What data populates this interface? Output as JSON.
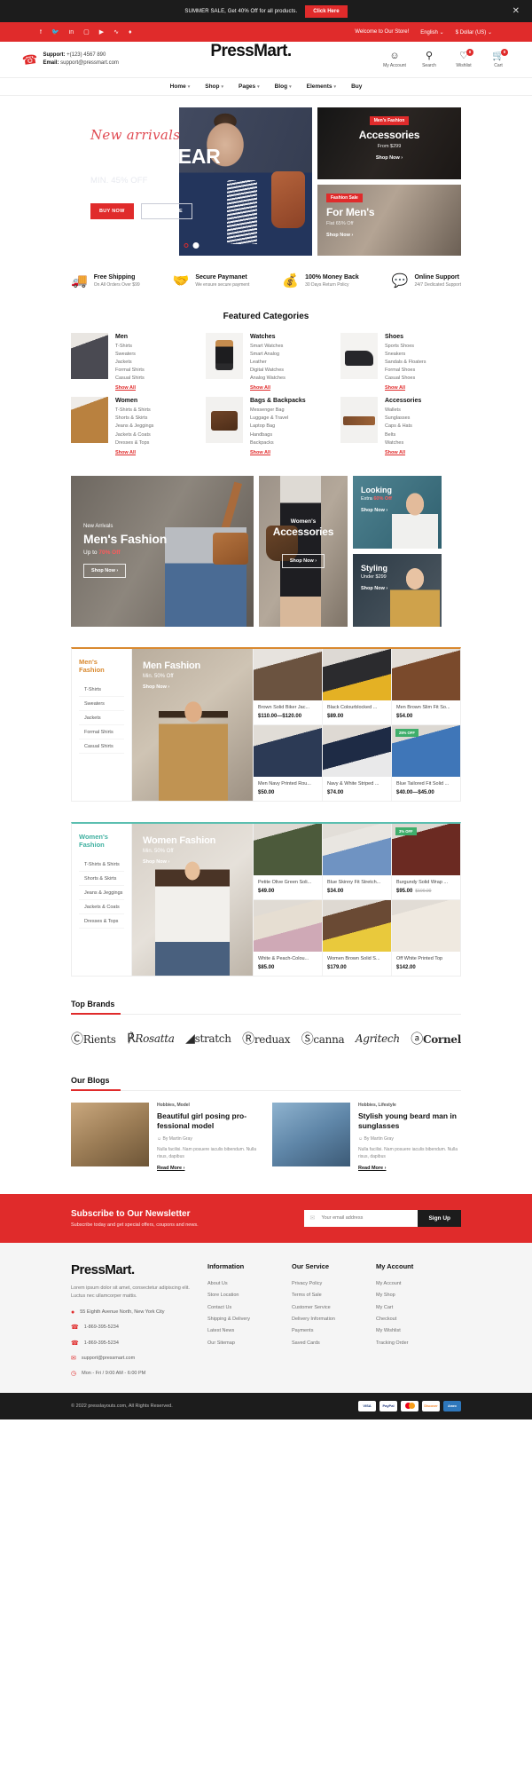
{
  "announcement": {
    "text": "SUMMER SALE, Get 40% Off for all products.",
    "button": "Click Here",
    "close_icon": "✕"
  },
  "topbar": {
    "socials": [
      "facebook-icon",
      "twitter-icon",
      "linkedin-icon",
      "instagram-icon",
      "youtube-icon",
      "rss-icon",
      "tumblr-icon"
    ],
    "welcome": "Welcome to Our Store!",
    "language": "English",
    "currency": "$ Dollar (US)"
  },
  "header": {
    "support_label": "Support:",
    "support_phone": "+(123) 4567 890",
    "email_label": "Email:",
    "email_value": "support@pressmart.com",
    "brand": "PressMart.",
    "icons": [
      {
        "name": "my-account",
        "label": "My Account",
        "glyph": "○",
        "badge": ""
      },
      {
        "name": "search",
        "label": "Search",
        "glyph": "⌕",
        "badge": ""
      },
      {
        "name": "wishlist",
        "label": "Wishlist",
        "glyph": "♡",
        "badge": "0"
      },
      {
        "name": "cart",
        "label": "Cart",
        "glyph": "☐",
        "badge": "0"
      }
    ]
  },
  "nav": [
    {
      "label": "Home",
      "caret": true
    },
    {
      "label": "Shop",
      "caret": true
    },
    {
      "label": "Pages",
      "caret": true
    },
    {
      "label": "Blog",
      "caret": true
    },
    {
      "label": "Elements",
      "caret": true
    },
    {
      "label": "Buy",
      "caret": false
    }
  ],
  "hero": {
    "script": "New arrivals",
    "title": "MEN'S WEAR",
    "subtitle": "MIN. 45% OFF",
    "buy_now": "BUY NOW",
    "read_more": "READ MORE",
    "side": [
      {
        "tag": "Men's Fashion",
        "title": "Accessories",
        "sub": "From $299",
        "cta": "Shop Now ›"
      },
      {
        "tag": "Fashion Sale",
        "title": "For Men's",
        "sub": "Flat 65% Off",
        "cta": "Shop Now ›"
      }
    ]
  },
  "services": [
    {
      "icon": "truck-icon",
      "title": "Free Shipping",
      "sub": "On All Orders Over $99"
    },
    {
      "icon": "handshake-icon",
      "title": "Secure Paymanet",
      "sub": "We ensure secure payment"
    },
    {
      "icon": "money-back-icon",
      "title": "100% Money Back",
      "sub": "30 Days Return Policy"
    },
    {
      "icon": "chat-icon",
      "title": "Online Support",
      "sub": "24/7 Dedicated Support"
    }
  ],
  "featured": {
    "title": "Featured Categories",
    "categories": [
      {
        "name": "Men",
        "thumb": "men",
        "items": [
          "T-Shirts",
          "Sweaters",
          "Jackets",
          "Formal Shirts",
          "Casual Shirts"
        ],
        "show": "Show All"
      },
      {
        "name": "Watches",
        "thumb": "watch",
        "items": [
          "Smart Watches",
          "Smart Analog",
          "Leather",
          "Digital Watches",
          "Analog Watches"
        ],
        "show": "Show All"
      },
      {
        "name": "Shoes",
        "thumb": "shoe",
        "items": [
          "Sports Shoes",
          "Sneakers",
          "Sandals & Floaters",
          "Formal Shoes",
          "Casual Shoes"
        ],
        "show": "Show All"
      },
      {
        "name": "Women",
        "thumb": "women",
        "items": [
          "T-Shirts & Shirts",
          "Shorts & Skirts",
          "Jeans & Jeggings",
          "Jackets & Coats",
          "Dresses & Tops"
        ],
        "show": "Show All"
      },
      {
        "name": "Bags & Backpacks",
        "thumb": "bag",
        "items": [
          "Messenger Bag",
          "Luggage & Travel",
          "Laptop Bag",
          "Handbags",
          "Backpacks"
        ],
        "show": "Show All"
      },
      {
        "name": "Accessories",
        "thumb": "acc",
        "items": [
          "Wallets",
          "Sunglasses",
          "Caps & Hats",
          "Belts",
          "Watches"
        ],
        "show": "Show All"
      }
    ]
  },
  "promos": {
    "a": {
      "kicker": "New Arrivals",
      "title": "Men's Fashion",
      "upto": "Up to ",
      "highlight": "70% Off",
      "cta": "Shop Now ›"
    },
    "b": {
      "kicker": "Women's",
      "title": "Accessories",
      "cta": "Shop Now ›"
    },
    "c": {
      "title": "Looking",
      "sub_prefix": "Extra ",
      "sub_highlight": "60% Off",
      "cta": "Shop Now ›"
    },
    "d": {
      "title": "Styling",
      "sub": "Under $299",
      "cta": "Shop Now ›"
    }
  },
  "men_block": {
    "tab_title": "Men's Fashion",
    "tabs": [
      "T-Shirts",
      "Sweaters",
      "Jackets",
      "Formal Shirts",
      "Casual Shirts"
    ],
    "feature": {
      "title": "Men Fashion",
      "sub": "Min. 50% Off",
      "cta": "Shop Now ›"
    },
    "products": [
      {
        "name": "Brown Solid Biker Jac...",
        "price": "$110.00—$120.00",
        "old": "",
        "badge": "",
        "img": "i1"
      },
      {
        "name": "Black Colourblocked ...",
        "price": "$89.00",
        "old": "",
        "badge": "",
        "img": "i2"
      },
      {
        "name": "Men Brown Slim Fit So...",
        "price": "$54.00",
        "old": "",
        "badge": "",
        "img": "i3"
      },
      {
        "name": "Men Navy Printed Rou...",
        "price": "$50.00",
        "old": "",
        "badge": "",
        "img": "i4"
      },
      {
        "name": "Navy & White Striped ...",
        "price": "$74.00",
        "old": "",
        "badge": "",
        "img": "i5"
      },
      {
        "name": "Blue Tailored Fit Solid ...",
        "price": "$40.00—$45.00",
        "old": "",
        "badge": "25% OFF",
        "img": "i6"
      }
    ]
  },
  "women_block": {
    "tab_title": "Women's Fashion",
    "tabs": [
      "T-Shirts & Shirts",
      "Shorts & Skirts",
      "Jeans & Jeggings",
      "Jackets & Coats",
      "Dresses & Tops"
    ],
    "feature": {
      "title": "Women Fashion",
      "sub": "Min. 50% Off",
      "cta": "Shop Now ›"
    },
    "products": [
      {
        "name": "Petite Olive Green Soli...",
        "price": "$49.00",
        "old": "",
        "badge": "",
        "img": "w1"
      },
      {
        "name": "Blue Skinny Fit Stretch...",
        "price": "$34.00",
        "old": "",
        "badge": "",
        "img": "w2"
      },
      {
        "name": "Burgundy Solid Wrap ...",
        "price": "$95.00",
        "old": "$100.00",
        "badge": "3% OFF",
        "img": "w3"
      },
      {
        "name": "White & Peach-Colou...",
        "price": "$85.00",
        "old": "",
        "badge": "",
        "img": "w4"
      },
      {
        "name": "Women Brown Solid S...",
        "price": "$179.00",
        "old": "",
        "badge": "",
        "img": "w5"
      },
      {
        "name": "Off White Printed Top",
        "price": "$142.00",
        "old": "",
        "badge": "",
        "img": "w6"
      }
    ]
  },
  "brands": {
    "title": "Top Brands",
    "items": [
      "Rients",
      "Rosatta",
      "stratch",
      "reduax",
      "canna",
      "Agritech",
      "Cornel"
    ]
  },
  "blogs": {
    "title": "Our Blogs",
    "posts": [
      {
        "meta": "Hobbies, Model",
        "title": "Beautiful girl posing pro-fessional model",
        "by": "By Martin Gray",
        "excerpt": "Nulla facilisi. Nam posuere iaculis bibendum. Nulla risus, dapibus",
        "more": "Read More ›",
        "img": "b1"
      },
      {
        "meta": "Hobbies, Lifestyle",
        "title": "Stylish young beard man in sunglasses",
        "by": "By Martin Gray",
        "excerpt": "Nulla facilisi. Nam posuere iaculis bibendum. Nulla risus, dapibus",
        "more": "Read More ›",
        "img": "b2"
      }
    ]
  },
  "newsletter": {
    "title": "Subscribe to Our Newsletter",
    "sub": "Subscribe today and get special offers, coupons and news.",
    "placeholder": "Your email address",
    "button": "Sign Up"
  },
  "footer": {
    "brand": "PressMart.",
    "about": "Lorem ipsum dolor sit amet, consectetur adipiscing elit. Luctus nec ullamcorper mattis.",
    "contacts": [
      {
        "icon": "pin-icon",
        "text": "55 Eighth Avenue North, New York City"
      },
      {
        "icon": "phone-icon",
        "text": "1-869-395-5234"
      },
      {
        "icon": "phone-icon",
        "text": "1-869-395-5234"
      },
      {
        "icon": "mail-icon",
        "text": "support@pressmart.com"
      },
      {
        "icon": "clock-icon",
        "text": "Mon - Fri / 9:00 AM - 6:00 PM"
      }
    ],
    "columns": [
      {
        "title": "Information",
        "links": [
          "About Us",
          "Store Location",
          "Contact Us",
          "Shipping & Delivery",
          "Latest News",
          "Our Sitemap"
        ]
      },
      {
        "title": "Our Service",
        "links": [
          "Privacy Policy",
          "Terms of Sale",
          "Customer Service",
          "Delivery Information",
          "Payments",
          "Saved Cards"
        ]
      },
      {
        "title": "My Account",
        "links": [
          "My Account",
          "My Shop",
          "My Cart",
          "Checkout",
          "My Wishlist",
          "Tracking Order"
        ]
      }
    ]
  },
  "copyright": {
    "text": "© 2022 presslayouts.com, All Rights Reserved.",
    "cards": [
      "VISA",
      "PayPal",
      "Mastercard",
      "Discover",
      "Amex"
    ]
  }
}
